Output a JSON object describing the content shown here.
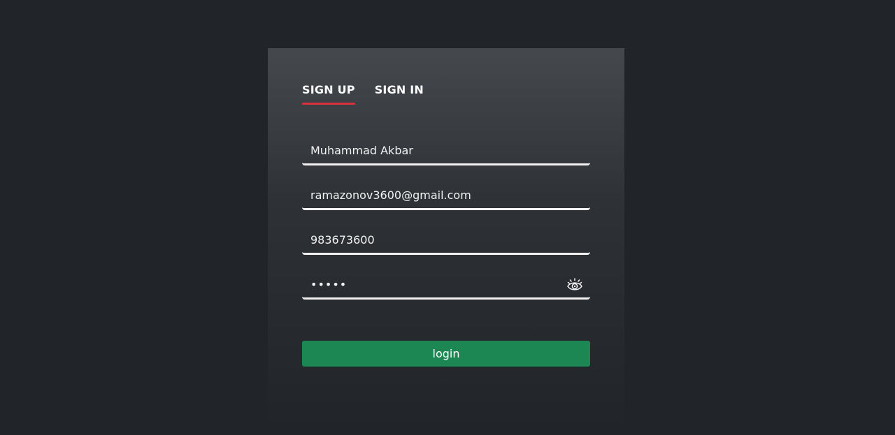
{
  "tabs": {
    "signup_label": "SIGN UP",
    "signin_label": "SIGN IN"
  },
  "form": {
    "name_value": "Muhammad Akbar",
    "email_value": "ramazonov3600@gmail.com",
    "phone_value": "983673600",
    "password_value": "•••••",
    "login_label": "login"
  },
  "icons": {
    "password_toggle": "eye-icon"
  },
  "colors": {
    "background": "#212429",
    "accent": "#d8323c",
    "button": "#1c8753"
  }
}
